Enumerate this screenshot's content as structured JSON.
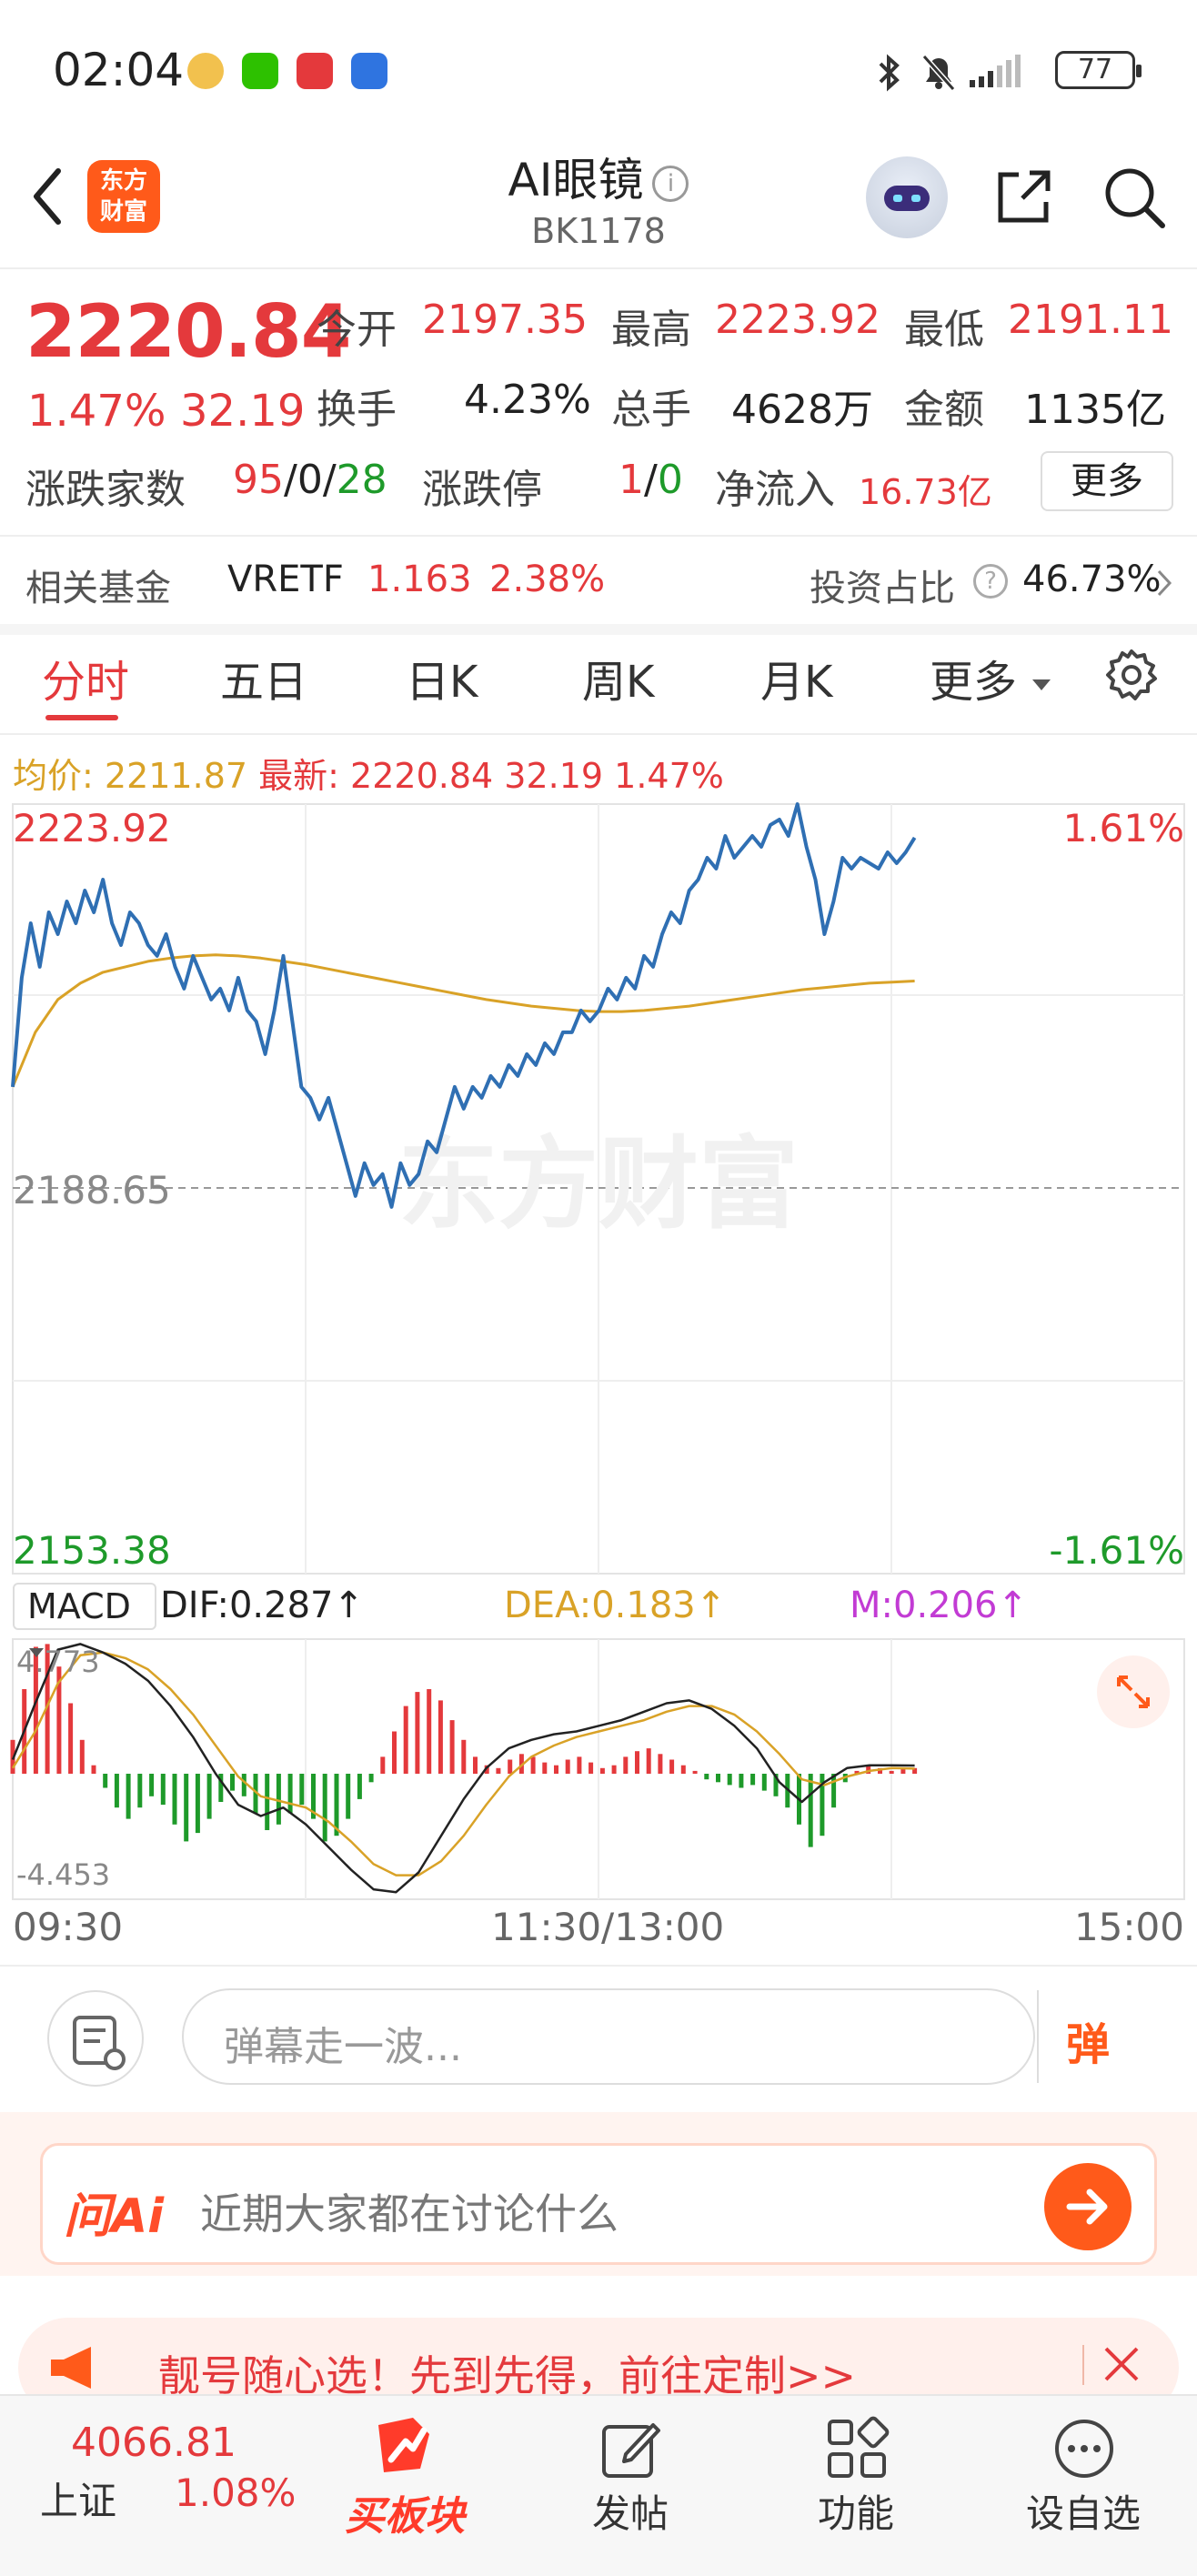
{
  "status_bar": {
    "time": "02:04",
    "battery": "77"
  },
  "header": {
    "back_icon": "chevron-left-icon",
    "logo_line1": "东方",
    "logo_line2": "财富",
    "title": "AI眼镜",
    "info_glyph": "i",
    "code": "BK1178"
  },
  "quote": {
    "price": "2220.84",
    "change_pct": "1.47%",
    "change": "32.19",
    "open_label": "今开",
    "open": "2197.35",
    "high_label": "最高",
    "high": "2223.92",
    "low_label": "最低",
    "low": "2191.11",
    "turnover_label": "换手",
    "turnover": "4.23%",
    "volume_label": "总手",
    "volume": "4628万",
    "amount_label": "金额",
    "amount": "1135亿",
    "breadth_label": "涨跌家数",
    "breadth_up": "95",
    "breadth_flat": "0",
    "breadth_down": "28",
    "slash": "/",
    "limit_label": "涨跌停",
    "limit_up": "1",
    "limit_down": "0",
    "netflow_label": "净流入",
    "netflow": "16.73亿",
    "more": "更多"
  },
  "fund": {
    "label": "相关基金",
    "name": "VRETF",
    "price": "1.163",
    "pct": "2.38%",
    "ratio_label": "投资占比",
    "ratio": "46.73%",
    "help_glyph": "?"
  },
  "tabs": [
    "分时",
    "五日",
    "日K",
    "周K",
    "月K",
    "更多"
  ],
  "legend": {
    "avg_label": "均价:",
    "avg": "2211.87",
    "latest_label": "最新:",
    "latest": "2220.84",
    "change": "32.19",
    "pct": "1.47%"
  },
  "macd": {
    "selector": "MACD",
    "dif": "DIF:0.287",
    "dea": "DEA:0.183",
    "m": "M:0.206",
    "max_label": "4.773",
    "min_label": "-4.453"
  },
  "comment": {
    "placeholder": "弹幕走一波...",
    "button": "弹"
  },
  "ask_ai": {
    "logo": "问Ai",
    "placeholder": "近期大家都在讨论什么"
  },
  "banner": {
    "text": "靓号随心选！先到先得，前往定制>>"
  },
  "bottom_nav": {
    "index_value": "4066.81",
    "index_name": "上证",
    "index_pct": "1.08%",
    "buy_label": "买板块",
    "post_label": "发帖",
    "func_label": "功能",
    "watch_label": "设自选"
  },
  "watermark": "东方财富",
  "colors": {
    "up": "#e4393c",
    "down": "#1e9a2a",
    "price_line": "#2f6fb3",
    "avg_line": "#d9a227",
    "dif_line": "#222222",
    "dea_line": "#d9a227",
    "m_color": "#c23bd4",
    "brand": "#ff5a1a"
  },
  "chart_data": [
    {
      "type": "line",
      "title": "",
      "x_ticks": [
        "09:30",
        "11:30/13:00",
        "15:00"
      ],
      "y_ticks_left": [
        "2223.92",
        "2188.65",
        "2153.38"
      ],
      "y_ticks_right": [
        "1.61%",
        "-1.61%"
      ],
      "ylim": [
        2153.38,
        2223.92
      ],
      "prev_close": 2188.65,
      "total_points": 240,
      "series": [
        {
          "name": "最新",
          "values": [
            2198.0,
            2208.0,
            2213.0,
            2209.0,
            2214.0,
            2212.0,
            2215.0,
            2213.0,
            2216.0,
            2214.0,
            2217.0,
            2213.0,
            2211.0,
            2214.0,
            2213.0,
            2211.0,
            2210.0,
            2212.0,
            2209.0,
            2207.0,
            2210.0,
            2208.0,
            2206.0,
            2207.0,
            2205.0,
            2208.0,
            2205.0,
            2204.0,
            2201.0,
            2205.0,
            2210.0,
            2204.0,
            2198.0,
            2197.0,
            2195.0,
            2197.0,
            2194.0,
            2191.0,
            2188.0,
            2191.0,
            2189.0,
            2190.0,
            2187.0,
            2191.0,
            2189.0,
            2190.0,
            2193.0,
            2192.0,
            2195.0,
            2198.0,
            2196.0,
            2198.0,
            2197.0,
            2199.0,
            2198.0,
            2200.0,
            2199.0,
            2201.0,
            2200.0,
            2202.0,
            2201.0,
            2203.0,
            2203.0,
            2205.0,
            2204.0,
            2205.0,
            2207.0,
            2206.0,
            2208.0,
            2207.0,
            2210.0,
            2209.0,
            2212.0,
            2214.0,
            2213.0,
            2216.0,
            2217.0,
            2219.0,
            2218.0,
            2221.0,
            2219.0,
            2220.0,
            2221.0,
            2220.0,
            2222.0,
            2222.5,
            2221.0,
            2223.92,
            2220.0,
            2217.0,
            2212.0,
            2215.0,
            2219.0,
            2218.0,
            2219.0,
            2218.5,
            2218.0,
            2219.5,
            2218.5,
            2219.5,
            2220.84
          ]
        },
        {
          "name": "均价",
          "values": [
            2198.0,
            2203.0,
            2206.0,
            2207.5,
            2208.5,
            2209.0,
            2209.5,
            2209.8,
            2210.0,
            2210.1,
            2210.0,
            2209.8,
            2209.5,
            2209.2,
            2208.8,
            2208.4,
            2208.0,
            2207.6,
            2207.2,
            2206.8,
            2206.4,
            2206.0,
            2205.7,
            2205.4,
            2205.2,
            2205.0,
            2204.9,
            2204.9,
            2205.0,
            2205.2,
            2205.4,
            2205.7,
            2206.0,
            2206.3,
            2206.6,
            2206.9,
            2207.1,
            2207.3,
            2207.5,
            2207.6,
            2207.7
          ]
        }
      ]
    },
    {
      "type": "bar",
      "title": "MACD",
      "ylim": [
        -4.453,
        4.773
      ],
      "series": [
        {
          "name": "M",
          "values": [
            1.2,
            3.0,
            4.5,
            4.6,
            3.8,
            2.5,
            1.2,
            0.3,
            -0.5,
            -1.2,
            -1.6,
            -1.2,
            -0.8,
            -1.1,
            -1.8,
            -2.4,
            -2.1,
            -1.6,
            -1.0,
            -0.6,
            -0.8,
            -1.4,
            -2.0,
            -1.8,
            -1.4,
            -1.1,
            -1.6,
            -2.4,
            -2.2,
            -1.6,
            -0.9,
            -0.3,
            0.6,
            1.5,
            2.4,
            2.9,
            3.0,
            2.6,
            1.9,
            1.2,
            0.6,
            0.3,
            0.2,
            0.5,
            0.7,
            0.6,
            0.4,
            0.3,
            0.5,
            0.6,
            0.4,
            0.2,
            0.3,
            0.6,
            0.8,
            0.9,
            0.7,
            0.5,
            0.3,
            0.1,
            -0.2,
            -0.3,
            -0.4,
            -0.5,
            -0.4,
            -0.6,
            -0.8,
            -1.2,
            -1.8,
            -2.6,
            -2.2,
            -1.2,
            -0.3,
            0.1,
            0.3,
            0.2,
            0.1,
            0.2,
            0.2
          ]
        },
        {
          "name": "DIF",
          "values": [
            0.5,
            2.5,
            4.4,
            4.6,
            4.3,
            3.9,
            3.3,
            2.4,
            1.3,
            0.0,
            -1.1,
            -1.5,
            -1.2,
            -1.8,
            -2.6,
            -3.4,
            -4.1,
            -4.2,
            -3.5,
            -2.2,
            -0.9,
            0.2,
            0.9,
            1.2,
            1.4,
            1.5,
            1.7,
            1.9,
            2.2,
            2.5,
            2.6,
            2.3,
            1.7,
            0.9,
            -0.3,
            -1.0,
            -0.3,
            0.2,
            0.3,
            0.3,
            0.29
          ]
        },
        {
          "name": "DEA",
          "values": [
            0.2,
            1.5,
            3.2,
            4.2,
            4.3,
            4.1,
            3.7,
            3.0,
            2.1,
            1.0,
            -0.1,
            -0.8,
            -1.0,
            -1.2,
            -1.7,
            -2.4,
            -3.2,
            -3.6,
            -3.6,
            -3.1,
            -2.2,
            -1.1,
            -0.1,
            0.6,
            1.0,
            1.3,
            1.5,
            1.7,
            1.9,
            2.2,
            2.4,
            2.4,
            2.1,
            1.5,
            0.7,
            -0.2,
            -0.4,
            -0.1,
            0.1,
            0.2,
            0.18
          ]
        }
      ]
    }
  ]
}
